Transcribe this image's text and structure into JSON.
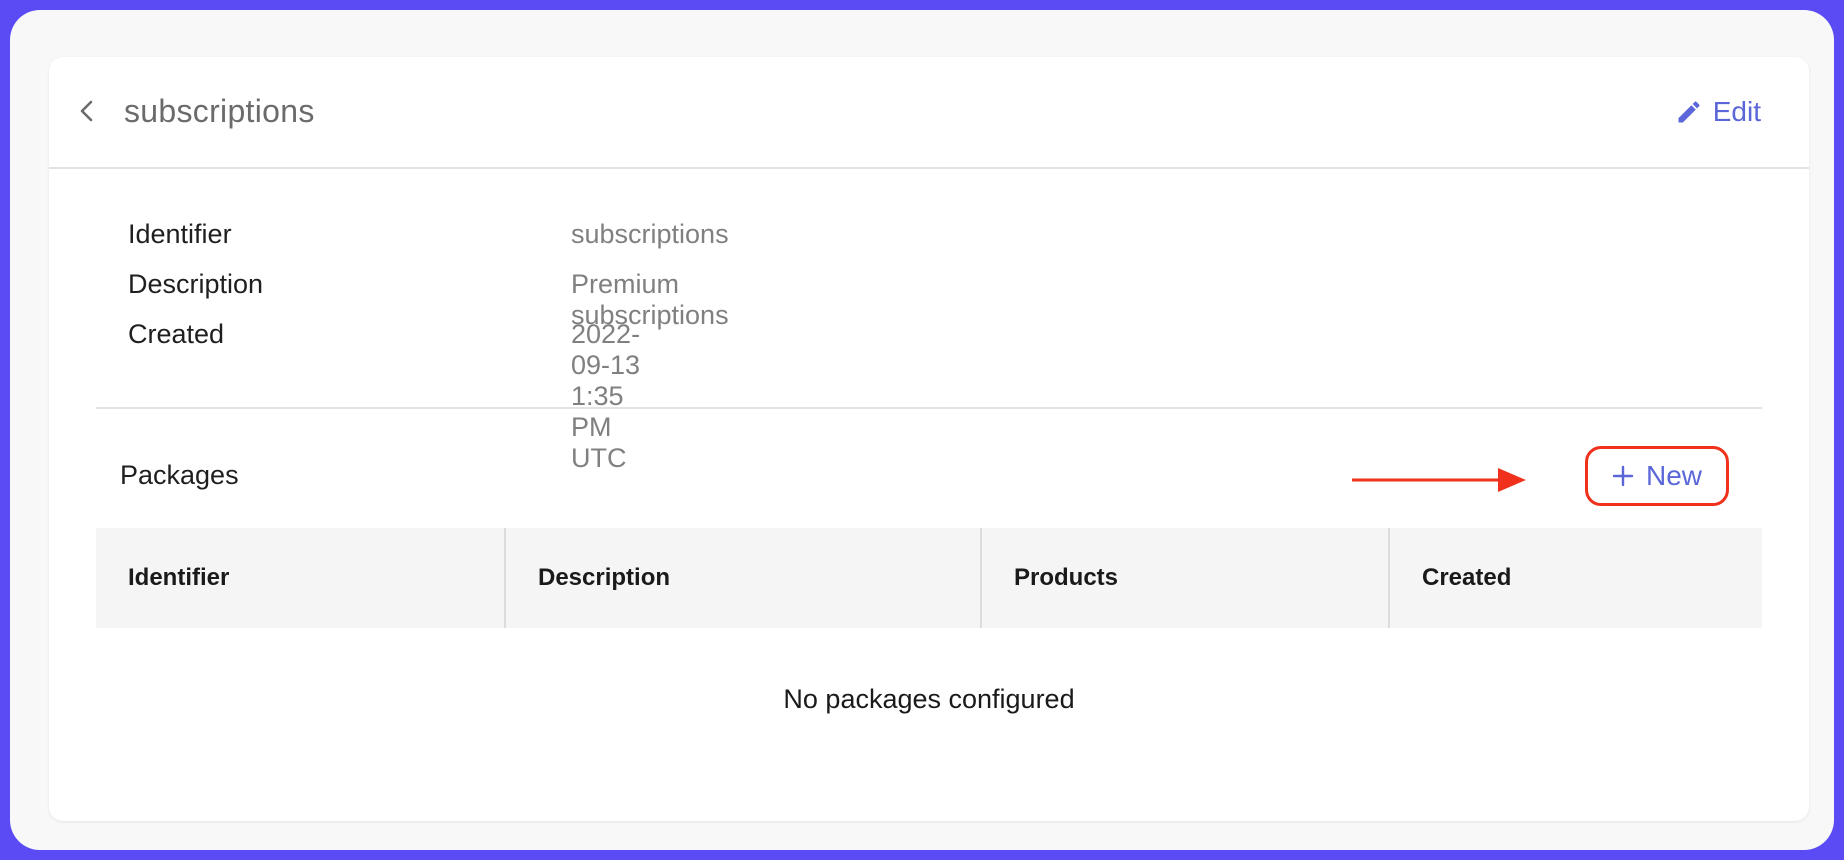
{
  "header": {
    "title": "subscriptions",
    "edit_label": "Edit",
    "back_icon": "chevron-left-icon",
    "edit_icon": "pencil-icon"
  },
  "details": [
    {
      "label": "Identifier",
      "value": "subscriptions"
    },
    {
      "label": "Description",
      "value": "Premium subscriptions"
    },
    {
      "label": "Created",
      "value": "2022-09-13 1:35 PM UTC"
    }
  ],
  "packages": {
    "title": "Packages",
    "new_label": "New",
    "new_icon": "plus-icon",
    "columns": [
      "Identifier",
      "Description",
      "Products",
      "Created"
    ],
    "empty_message": "No packages configured"
  },
  "colors": {
    "frame": "#5a4bf5",
    "accent": "#5b67d8",
    "highlight": "#f0311b"
  }
}
